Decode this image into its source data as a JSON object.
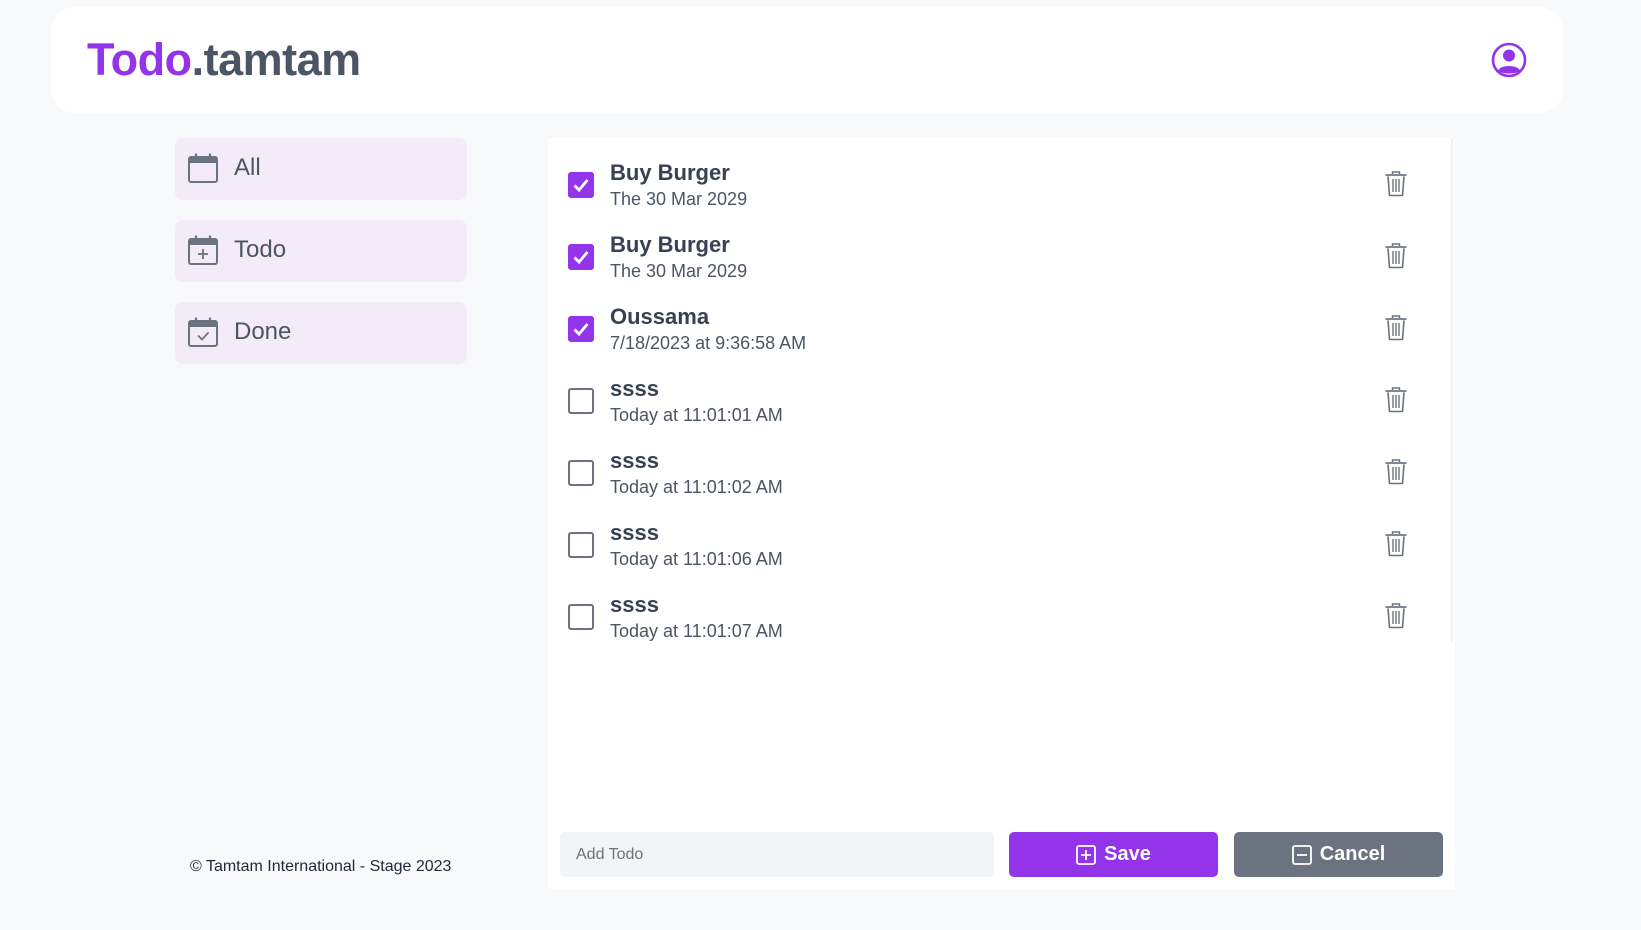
{
  "header": {
    "brand_main": "Todo",
    "brand_suffix": ".tamtam",
    "brand_color": "#9333ea",
    "user_icon": "user-circle-icon"
  },
  "sidebar": {
    "items": [
      {
        "label": "All",
        "icon": "calendar-icon"
      },
      {
        "label": "Todo",
        "icon": "calendar-plus-icon"
      },
      {
        "label": "Done",
        "icon": "calendar-check-icon"
      }
    ]
  },
  "todos": [
    {
      "title": "Buy Burger",
      "date": "The 30 Mar 2029",
      "done": true
    },
    {
      "title": "Buy Burger",
      "date": "The 30 Mar 2029",
      "done": true
    },
    {
      "title": "Oussama",
      "date": "7/18/2023 at 9:36:58 AM",
      "done": true
    },
    {
      "title": "ssss",
      "date": "Today at 11:01:01 AM",
      "done": false
    },
    {
      "title": "ssss",
      "date": "Today at 11:01:02 AM",
      "done": false
    },
    {
      "title": "ssss",
      "date": "Today at 11:01:06 AM",
      "done": false
    },
    {
      "title": "ssss",
      "date": "Today at 11:01:07 AM",
      "done": false
    }
  ],
  "composer": {
    "placeholder": "Add Todo",
    "value": "",
    "save_label": "Save",
    "cancel_label": "Cancel"
  },
  "footer": {
    "text": "© Tamtam International - Stage 2023"
  },
  "colors": {
    "accent": "#9333ea",
    "muted_button": "#6b7280",
    "nav_bg": "#f3ebf7"
  }
}
